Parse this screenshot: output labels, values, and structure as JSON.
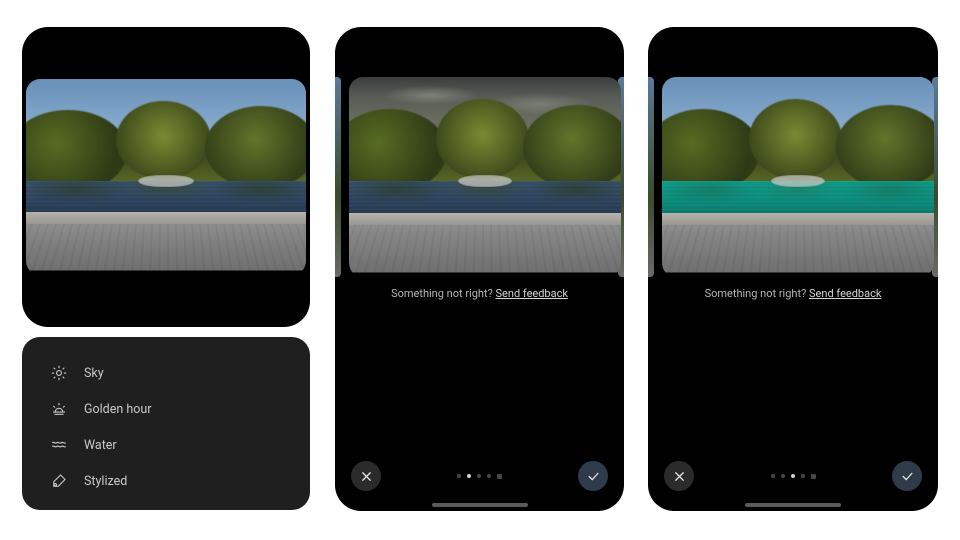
{
  "menu": {
    "items": [
      {
        "label": "Sky"
      },
      {
        "label": "Golden hour"
      },
      {
        "label": "Water"
      },
      {
        "label": "Stylized"
      }
    ]
  },
  "editor": {
    "feedback_prompt": "Something not right? ",
    "feedback_link": "Send feedback",
    "total_pages": 5
  },
  "panel_c": {
    "active_page_index": 1
  },
  "panel_d": {
    "active_page_index": 2
  }
}
